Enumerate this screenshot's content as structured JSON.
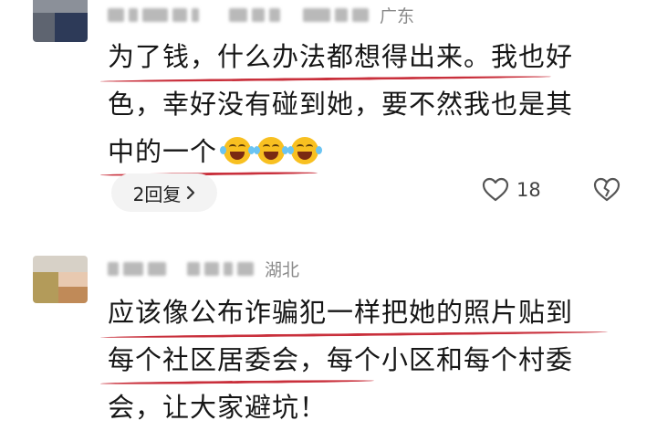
{
  "comments": [
    {
      "location": "广东",
      "lines": [
        "为了钱，什么办法都想得出来。我也好",
        "色，幸好没有碰到她，要不然我也是其",
        "中的一个"
      ],
      "emojis": [
        "laughing-with-tears-icon",
        "laughing-with-tears-icon",
        "laughing-with-tears-icon"
      ],
      "reply_label": "2回复",
      "like_count": "18"
    },
    {
      "location": "湖北",
      "lines": [
        "应该像公布诈骗犯一样把她的照片贴到",
        "每个社区居委会，每个小区和每个村委",
        "会，让大家避坑！"
      ]
    }
  ],
  "colors": {
    "underline": "#c9303c",
    "location": "#8a8a8a",
    "reply_bg": "#f3f3f3"
  }
}
